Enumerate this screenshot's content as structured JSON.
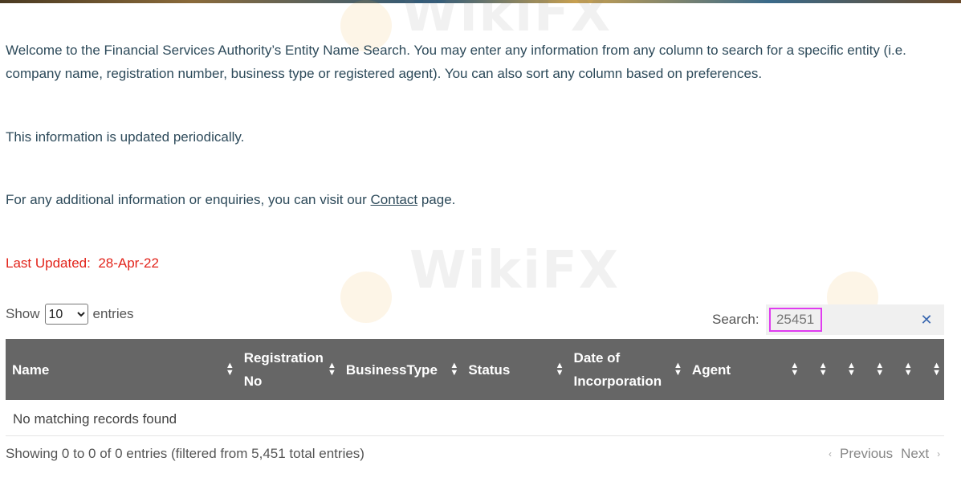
{
  "intro": {
    "text": "Welcome to the Financial Services Authority’s Entity Name Search. You may enter any information from any column to search for a specific entity (i.e. company name, registration number, business type or registered agent). You can also sort any column based on preferences.",
    "update_note": "This information is updated periodically.",
    "contact_prefix": "For any additional information or enquiries, you can visit our ",
    "contact_link": "Contact",
    "contact_suffix": " page."
  },
  "last_updated": {
    "label": "Last Updated:",
    "value": "28-Apr-22"
  },
  "length_control": {
    "prefix": "Show",
    "selected": "10",
    "suffix": "entries"
  },
  "search": {
    "label": "Search:",
    "value": "25451",
    "clear_icon": "close-icon"
  },
  "table": {
    "columns": [
      "Name",
      "Registration No",
      "BusinessType",
      "Status",
      "Date of Incorporation",
      "Agent",
      "",
      "",
      "",
      "",
      ""
    ],
    "empty_message": "No matching records found"
  },
  "footer": {
    "info": "Showing 0 to 0 of 0 entries (filtered from 5,451 total entries)",
    "previous": "Previous",
    "next": "Next"
  },
  "watermark": {
    "text": "WikiFX"
  },
  "colors": {
    "header_bg": "#666666",
    "updated_red": "#e2231a",
    "search_highlight": "#e03cf0"
  }
}
